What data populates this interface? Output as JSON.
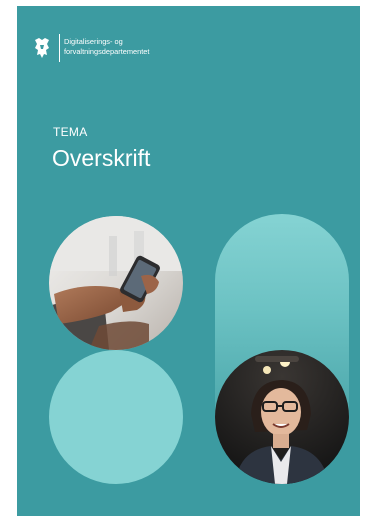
{
  "header": {
    "logo_icon": "norwegian-coat-of-arms-icon",
    "ministry_line1": "Digitaliserings- og",
    "ministry_line2": "forvaltningsdepartementet"
  },
  "cover": {
    "kicker": "TEMA",
    "title": "Overskrift"
  },
  "images": {
    "photo1": "hands-holding-smartphone-photo",
    "photo2": "smiling-woman-looking-up-photo"
  },
  "colors": {
    "background": "#3c9ba1",
    "light_teal": "#85d3d3",
    "text": "#ffffff"
  }
}
